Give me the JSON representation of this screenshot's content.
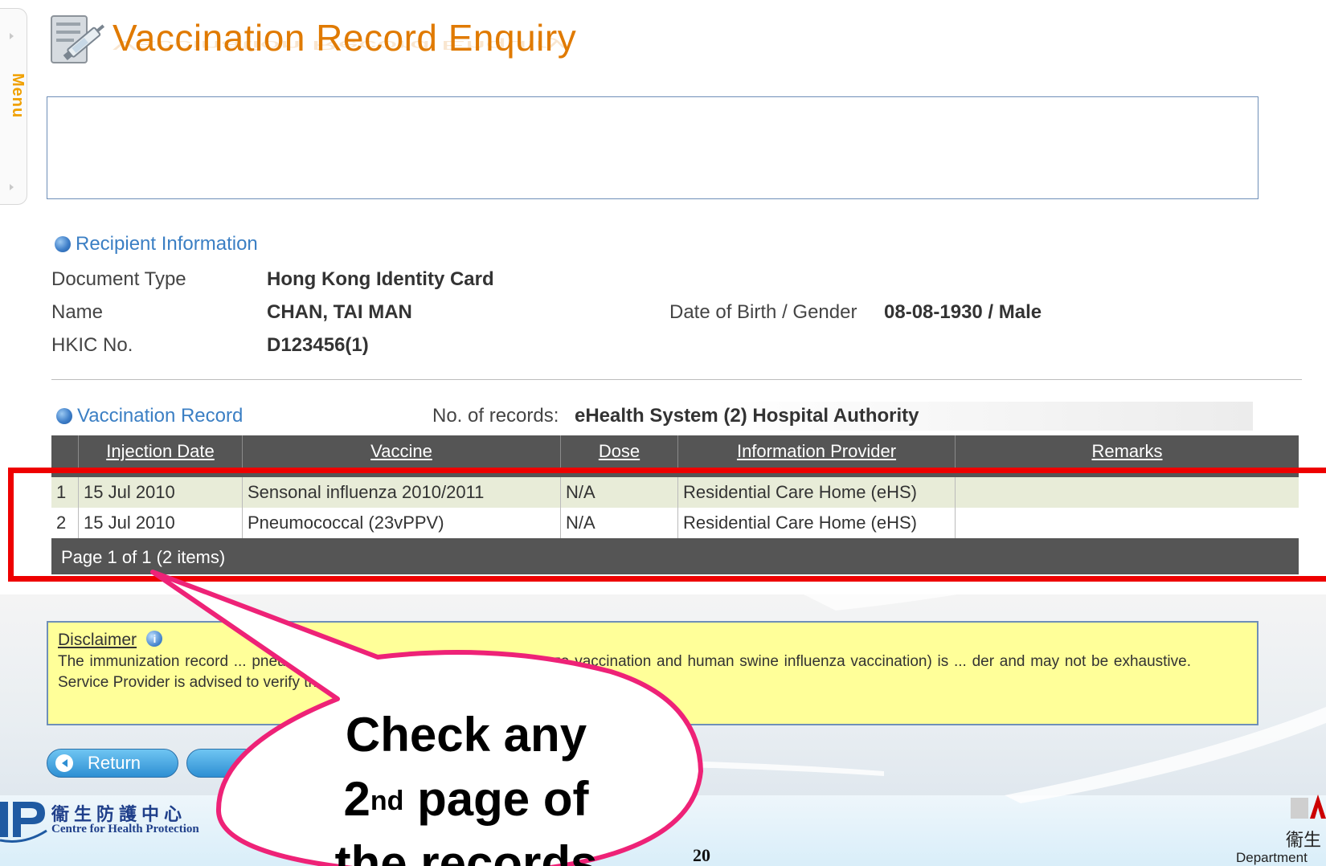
{
  "side_menu": {
    "label": "Menu"
  },
  "page": {
    "title": "Vaccination Record Enquiry"
  },
  "recipient": {
    "heading": "Recipient Information",
    "document_type_label": "Document Type",
    "document_type_value": "Hong Kong Identity Card",
    "name_label": "Name",
    "name_value": "CHAN, TAI MAN",
    "dob_gender_label": "Date of Birth / Gender",
    "dob_gender_value": "08-08-1930 / Male",
    "hkic_label": "HKIC No.",
    "hkic_value": "D123456(1)"
  },
  "records": {
    "heading": "Vaccination Record",
    "count_label": "No. of records:",
    "count_value": "eHealth System (2) Hospital Authority",
    "columns": [
      "Injection Date",
      "Vaccine",
      "Dose",
      "Information Provider",
      "Remarks"
    ],
    "rows": [
      {
        "no": "1",
        "date": "15 Jul 2010",
        "vaccine": "Sensonal influenza 2010/2011",
        "dose": "N/A",
        "provider": "Residential Care Home (eHS)",
        "remarks": ""
      },
      {
        "no": "2",
        "date": "15 Jul 2010",
        "vaccine": "Pneumococcal (23vPPV)",
        "dose": "N/A",
        "provider": "Residential Care Home (eHS)",
        "remarks": ""
      }
    ],
    "pager": "Page 1 of 1 (2 items)"
  },
  "disclaimer": {
    "title": "Disclaimer",
    "info_glyph": "i",
    "text": "The immunization record ... pneumococcal vaccination, seasonal influenza vaccination and human swine influenza vaccination) is ... der and may not be exhaustive. Service Provider is advised to verify the vaccination history with ..."
  },
  "buttons": {
    "return_label": "Return"
  },
  "callout": {
    "line1": "Check any",
    "line2_prefix": "2",
    "line2_sup": "nd",
    "line2_suffix": " page of",
    "line3": "the records"
  },
  "footer": {
    "chp_cn": "衞生防護中心",
    "chp_en": "Centre for Health Protection",
    "page_number": "20",
    "dept_cn": "衞生",
    "dept_en": "Department"
  },
  "colors": {
    "title": "#e07a00",
    "accent_blue": "#3b7fc4",
    "grid": "#555555",
    "highlight": "#ee0000",
    "callout": "#ee2277",
    "disclaimer_bg": "#ffff99"
  }
}
